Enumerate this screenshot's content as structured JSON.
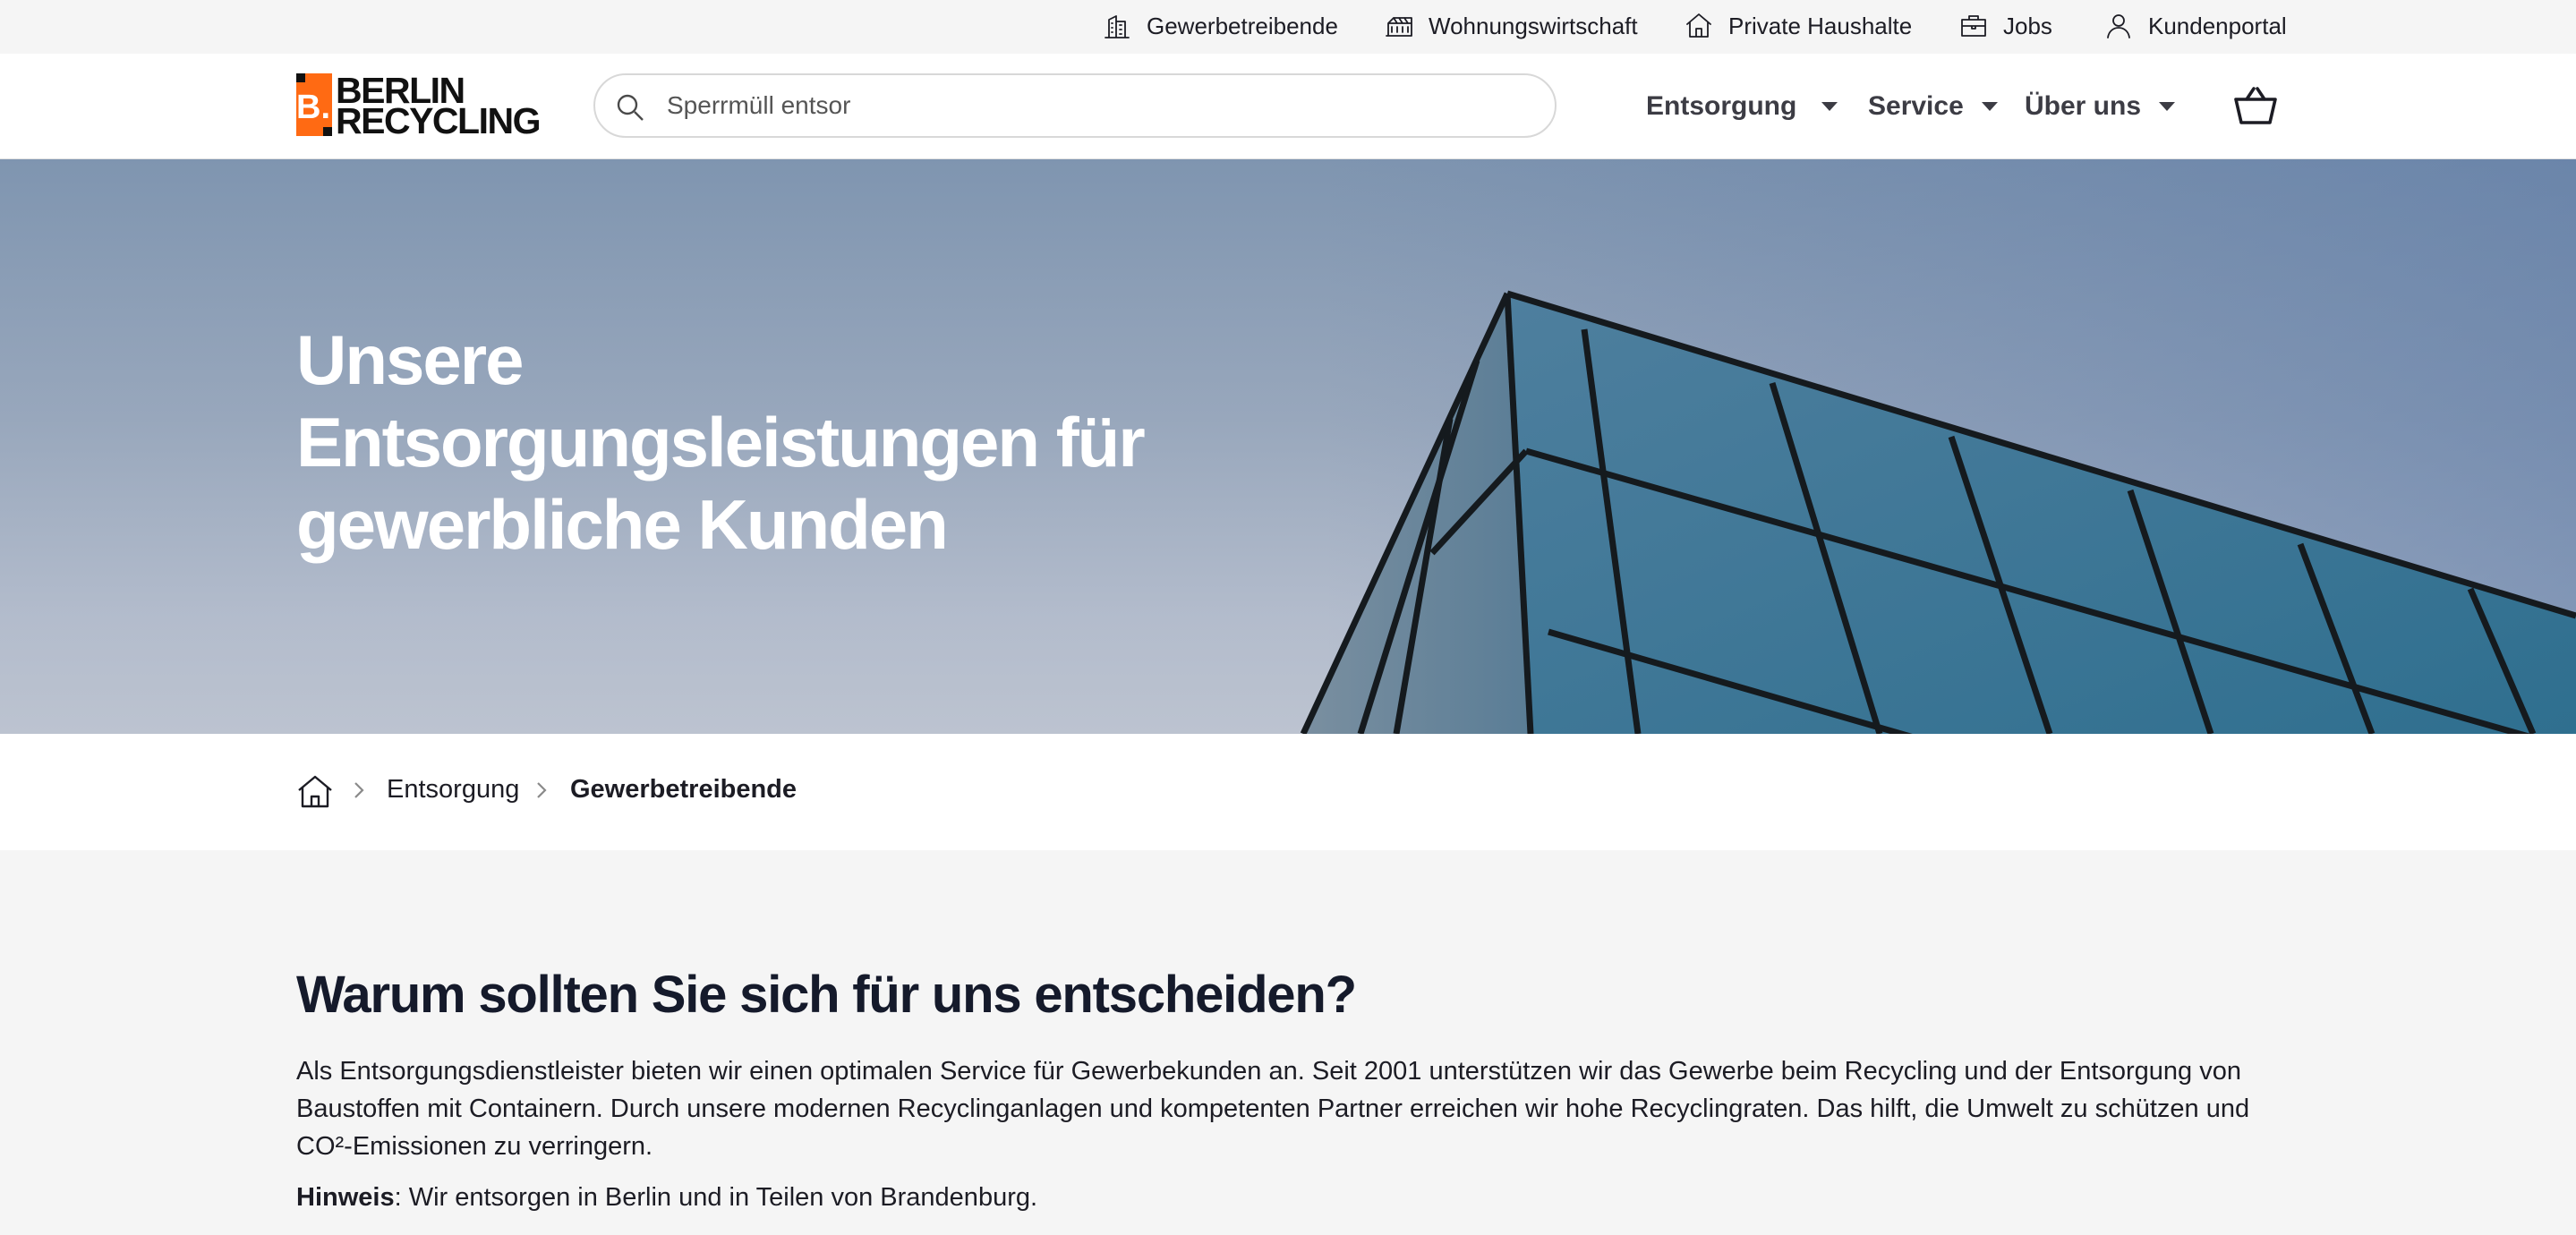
{
  "topbar": {
    "items": [
      {
        "label": "Gewerbetreibende",
        "icon": "building-icon"
      },
      {
        "label": "Wohnungswirtschaft",
        "icon": "apartment-icon"
      },
      {
        "label": "Private Haushalte",
        "icon": "house-icon"
      },
      {
        "label": "Jobs",
        "icon": "briefcase-icon"
      },
      {
        "label": "Kundenportal",
        "icon": "user-icon"
      }
    ]
  },
  "header": {
    "logo_line1": "BERLIN",
    "logo_line2": "RECYCLING",
    "logo_mark": "B.",
    "brand_color": "#ff6a13",
    "search_value": "Sperrmüll entsor",
    "nav": [
      {
        "label": "Entsorgung"
      },
      {
        "label": "Service"
      },
      {
        "label": "Über uns"
      }
    ]
  },
  "hero": {
    "title_line1": "Unsere",
    "title_line2": "Entsorgungsleistungen für",
    "title_line3": "gewerbliche Kunden"
  },
  "breadcrumb": {
    "items": [
      "Entsorgung"
    ],
    "current": "Gewerbetreibende"
  },
  "content": {
    "title": "Warum sollten Sie sich für uns entscheiden?",
    "text": "Als Entsorgungsdienstleister bieten wir einen optimalen Service für Gewerbekunden an. Seit 2001 unterstützen wir das Gewerbe beim Recycling und der Entsorgung von Baustoffen mit Containern. Durch unsere modernen Recyclinganlagen und kompetenten Partner erreichen wir hohe Recyclingraten. Das hilft, die Umwelt zu schützen und CO²-Emissionen zu verringern.",
    "note_label": "Hinweis",
    "note_text": ": Wir entsorgen in Berlin und in Teilen von Brandenburg."
  }
}
